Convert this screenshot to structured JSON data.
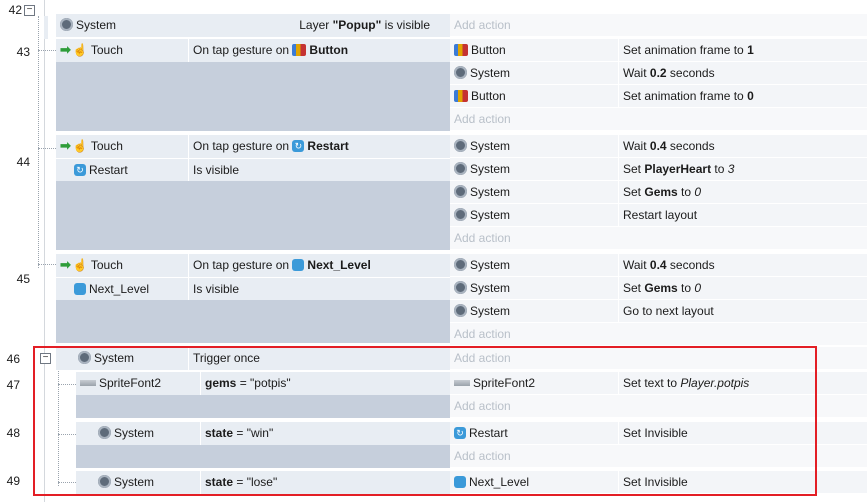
{
  "rows": {
    "r42": {
      "num": "42",
      "obj": "System",
      "cond_pre": "Layer ",
      "cond_bold": "\"Popup\"",
      "cond_post": " is visible",
      "add": "Add action"
    },
    "r43": {
      "num": "43",
      "obj": "Touch",
      "cond_pre": "On tap gesture on ",
      "cond_bold": "Button",
      "actions": [
        {
          "obj": "Button",
          "pre": "Set animation frame to ",
          "bold": "1"
        },
        {
          "obj": "System",
          "pre": "Wait ",
          "bold": "0.2",
          "post": " seconds"
        },
        {
          "obj": "Button",
          "pre": "Set animation frame to ",
          "bold": "0"
        }
      ],
      "add": "Add action"
    },
    "r44": {
      "num": "44",
      "conds": [
        {
          "obj": "Touch",
          "pre": "On tap gesture on ",
          "bold": "Restart"
        },
        {
          "obj": "Restart",
          "pre": "Is visible"
        }
      ],
      "actions": [
        {
          "obj": "System",
          "pre": "Wait ",
          "bold": "0.4",
          "post": " seconds"
        },
        {
          "obj": "System",
          "pre": "Set ",
          "bold": "PlayerHeart",
          "post": " to ",
          "ital": "3"
        },
        {
          "obj": "System",
          "pre": "Set ",
          "bold": "Gems",
          "post": " to ",
          "ital": "0"
        },
        {
          "obj": "System",
          "pre": "Restart layout"
        }
      ],
      "add": "Add action"
    },
    "r45": {
      "num": "45",
      "conds": [
        {
          "obj": "Touch",
          "pre": "On tap gesture on ",
          "bold": "Next_Level"
        },
        {
          "obj": "Next_Level",
          "pre": "Is visible"
        }
      ],
      "actions": [
        {
          "obj": "System",
          "pre": "Wait ",
          "bold": "0.4",
          "post": " seconds"
        },
        {
          "obj": "System",
          "pre": "Set ",
          "bold": "Gems",
          "post": " to ",
          "ital": "0"
        },
        {
          "obj": "System",
          "pre": "Go to next layout"
        }
      ],
      "add": "Add action"
    },
    "r46": {
      "num": "46",
      "obj": "System",
      "cond": "Trigger once",
      "add": "Add action"
    },
    "r47": {
      "num": "47",
      "obj": "SpriteFont2",
      "cond_bold": "gems",
      "cond_post": " = \"potpis\"",
      "act_obj": "SpriteFont2",
      "act_pre": "Set text to ",
      "act_ital": "Player.potpis",
      "add": "Add action"
    },
    "r48": {
      "num": "48",
      "obj": "System",
      "cond_bold": "state",
      "cond_post": " = \"win\"",
      "act_obj": "Restart",
      "act": "Set Invisible",
      "add": "Add action"
    },
    "r49": {
      "num": "49",
      "obj": "System",
      "cond_bold": "state",
      "cond_post": " = \"lose\"",
      "act_obj": "Next_Level",
      "act": "Set Invisible"
    }
  },
  "colors": {
    "highlight": "#e31e25",
    "condition_bg": "#c6cfdc",
    "header_bg": "#dfe6ef"
  }
}
